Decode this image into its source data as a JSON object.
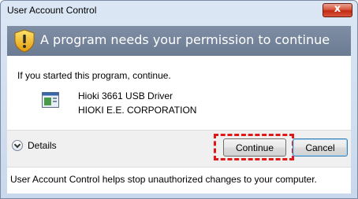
{
  "window": {
    "title": "User Account Control",
    "close_label": "x"
  },
  "header": {
    "text": "A program needs your permission to continue",
    "icon": "shield-warning-icon"
  },
  "content": {
    "intro": "If you started this program, continue.",
    "program_name": "Hioki 3661 USB Driver",
    "publisher": "HIOKI E.E. CORPORATION",
    "program_icon": "application-window-icon"
  },
  "details": {
    "label": "Details",
    "icon": "chevron-down-icon"
  },
  "buttons": {
    "continue": "Continue",
    "cancel": "Cancel"
  },
  "footer": {
    "text": "User Account Control helps stop unauthorized changes to your computer."
  },
  "colors": {
    "header_bg": "#7f8ea4",
    "highlight": "#e01818",
    "close_red": "#c22a10"
  }
}
